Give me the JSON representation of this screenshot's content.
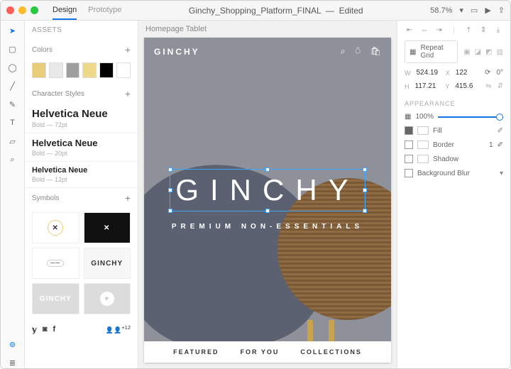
{
  "titlebar": {
    "tabs": [
      "Design",
      "Prototype"
    ],
    "active_tab": "Design",
    "doc": "Ginchy_Shopping_Platform_FINAL",
    "status": "Edited",
    "zoom": "58.7%"
  },
  "assets": {
    "header": "ASSETS",
    "colors_label": "Colors",
    "colors": [
      "#e8cc7a",
      "#e8e8e8",
      "#9e9e9e",
      "#eed98a",
      "#000000",
      "#ffffff"
    ],
    "char_label": "Character Styles",
    "char_styles": [
      {
        "name": "Helvetica Neue",
        "meta": "Bold — 72pt",
        "size": "15px"
      },
      {
        "name": "Helvetica Neue",
        "meta": "Bold — 20pt",
        "size": "13px"
      },
      {
        "name": "Helvetica Neue",
        "meta": "Bold — 12pt",
        "size": "11px"
      }
    ],
    "symbols_label": "Symbols",
    "symbols": [
      "ring-x",
      "dark-x",
      "dot",
      "ginchy",
      "ginchy-gray",
      "heart"
    ]
  },
  "canvas": {
    "artboard_label": "Homepage Tablet",
    "brand": "GINCHY",
    "hero_title": "GINCHY",
    "subtitle": "PREMIUM   NON-ESSENTIALS",
    "bottom_nav": [
      "FEATURED",
      "FOR YOU",
      "COLLECTIONS"
    ]
  },
  "props": {
    "repeat_label": "Repeat Grid",
    "w_label": "W",
    "w_val": "524.19",
    "x_label": "X",
    "x_val": "122",
    "h_label": "H",
    "h_val": "117.21",
    "y_label": "Y",
    "y_val": "415.6",
    "rot": "0°",
    "appearance_label": "APPEARANCE",
    "opacity": "100%",
    "fill_label": "Fill",
    "border_label": "Border",
    "border_w": "1",
    "shadow_label": "Shadow",
    "blur_label": "Background Blur"
  }
}
